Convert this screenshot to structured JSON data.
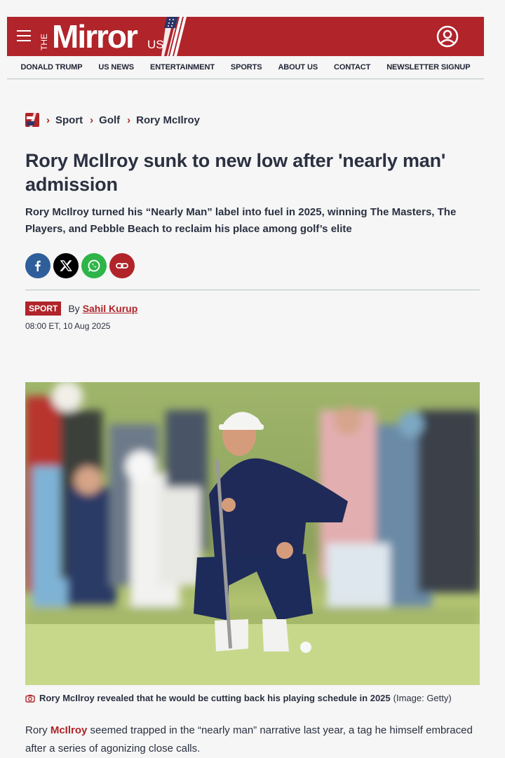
{
  "header": {
    "logo_the": "THE",
    "logo_mirror": "Mirror",
    "logo_us": "US"
  },
  "nav": {
    "items": [
      "DONALD TRUMP",
      "US NEWS",
      "ENTERTAINMENT",
      "SPORTS",
      "ABOUT US",
      "CONTACT",
      "NEWSLETTER SIGNUP"
    ]
  },
  "breadcrumb": {
    "items": [
      "Sport",
      "Golf"
    ],
    "current": "Rory McIlroy"
  },
  "article": {
    "headline": "Rory McIlroy sunk to new low after 'nearly man' admission",
    "standfirst": "Rory McIlroy turned his “Nearly Man” label into fuel in 2025, winning The Masters, The Players, and Pebble Beach to reclaim his place among golf’s elite",
    "tag": "SPORT",
    "by_label": "By",
    "author": "Sahil Kurup",
    "date": "08:00 ET, 10 Aug 2025",
    "caption": "Rory McIlroy revealed that he would be cutting back his playing schedule in 2025",
    "credit": "(Image: Getty)",
    "body_prefix": "Rory ",
    "body_link": "McIlroy",
    "body_rest": " seemed trapped in the “nearly man” narrative last year, a tag he himself embraced after a series of agonizing close calls."
  },
  "share": {
    "icons": [
      "facebook-icon",
      "x-icon",
      "whatsapp-icon",
      "link-icon"
    ]
  },
  "colors": {
    "brand_red": "#b0242a",
    "text_dark": "#2b3041",
    "background": "#f5f6f5"
  }
}
